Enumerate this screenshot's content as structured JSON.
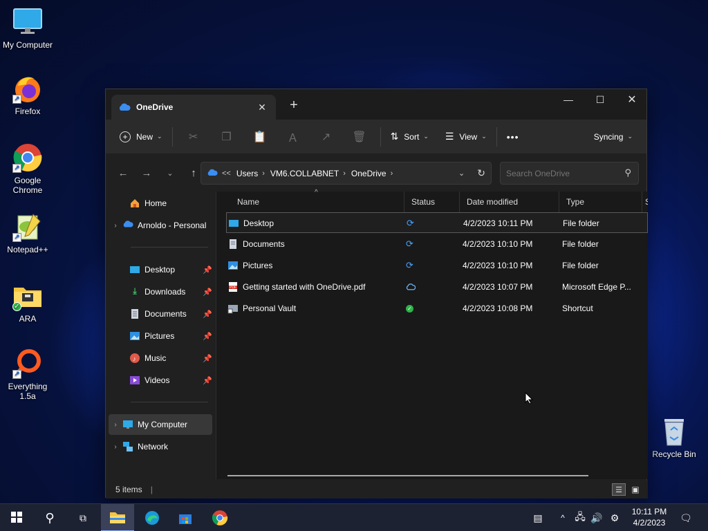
{
  "desktop": {
    "icons": [
      {
        "label": "My Computer"
      },
      {
        "label": "Firefox"
      },
      {
        "label": "Google Chrome"
      },
      {
        "label": "Notepad++"
      },
      {
        "label": "ARA"
      },
      {
        "label": "Everything 1.5a"
      },
      {
        "label": "Recycle Bin"
      }
    ]
  },
  "window": {
    "tab_title": "OneDrive",
    "toolbar": {
      "new_label": "New",
      "sort_label": "Sort",
      "view_label": "View",
      "more_label": "•••",
      "sync_label": "Syncing"
    },
    "address": {
      "overflow": "<<",
      "segments": [
        "Users",
        "VM6.COLLABNET",
        "OneDrive"
      ]
    },
    "search": {
      "placeholder": "Search OneDrive"
    },
    "sidebar": {
      "home": "Home",
      "onedrive": "Arnoldo - Personal",
      "quick": [
        {
          "label": "Desktop"
        },
        {
          "label": "Downloads"
        },
        {
          "label": "Documents"
        },
        {
          "label": "Pictures"
        },
        {
          "label": "Music"
        },
        {
          "label": "Videos"
        }
      ],
      "computer": "My Computer",
      "network": "Network"
    },
    "columns": {
      "name": "Name",
      "status": "Status",
      "date": "Date modified",
      "type": "Type",
      "size_partial": "S"
    },
    "files": [
      {
        "name": "Desktop",
        "status": "syncing",
        "date": "4/2/2023 10:11 PM",
        "type": "File folder"
      },
      {
        "name": "Documents",
        "status": "syncing",
        "date": "4/2/2023 10:10 PM",
        "type": "File folder"
      },
      {
        "name": "Pictures",
        "status": "syncing",
        "date": "4/2/2023 10:10 PM",
        "type": "File folder"
      },
      {
        "name": "Getting started with OneDrive.pdf",
        "status": "online",
        "date": "4/2/2023 10:07 PM",
        "type": "Microsoft Edge P..."
      },
      {
        "name": "Personal Vault",
        "status": "available",
        "date": "4/2/2023 10:08 PM",
        "type": "Shortcut"
      }
    ],
    "status_text": "5 items"
  },
  "taskbar": {
    "apps": [
      "start-icon",
      "search-icon",
      "task-view-icon",
      "file-explorer-icon",
      "edge-icon",
      "store-icon",
      "chrome-icon"
    ],
    "clock": {
      "time": "10:11 PM",
      "date": "4/2/2023"
    }
  },
  "colors": {
    "sync_blue": "#4aa3ff",
    "ok_green": "#2fb34a",
    "accent": "#4c8dff"
  }
}
